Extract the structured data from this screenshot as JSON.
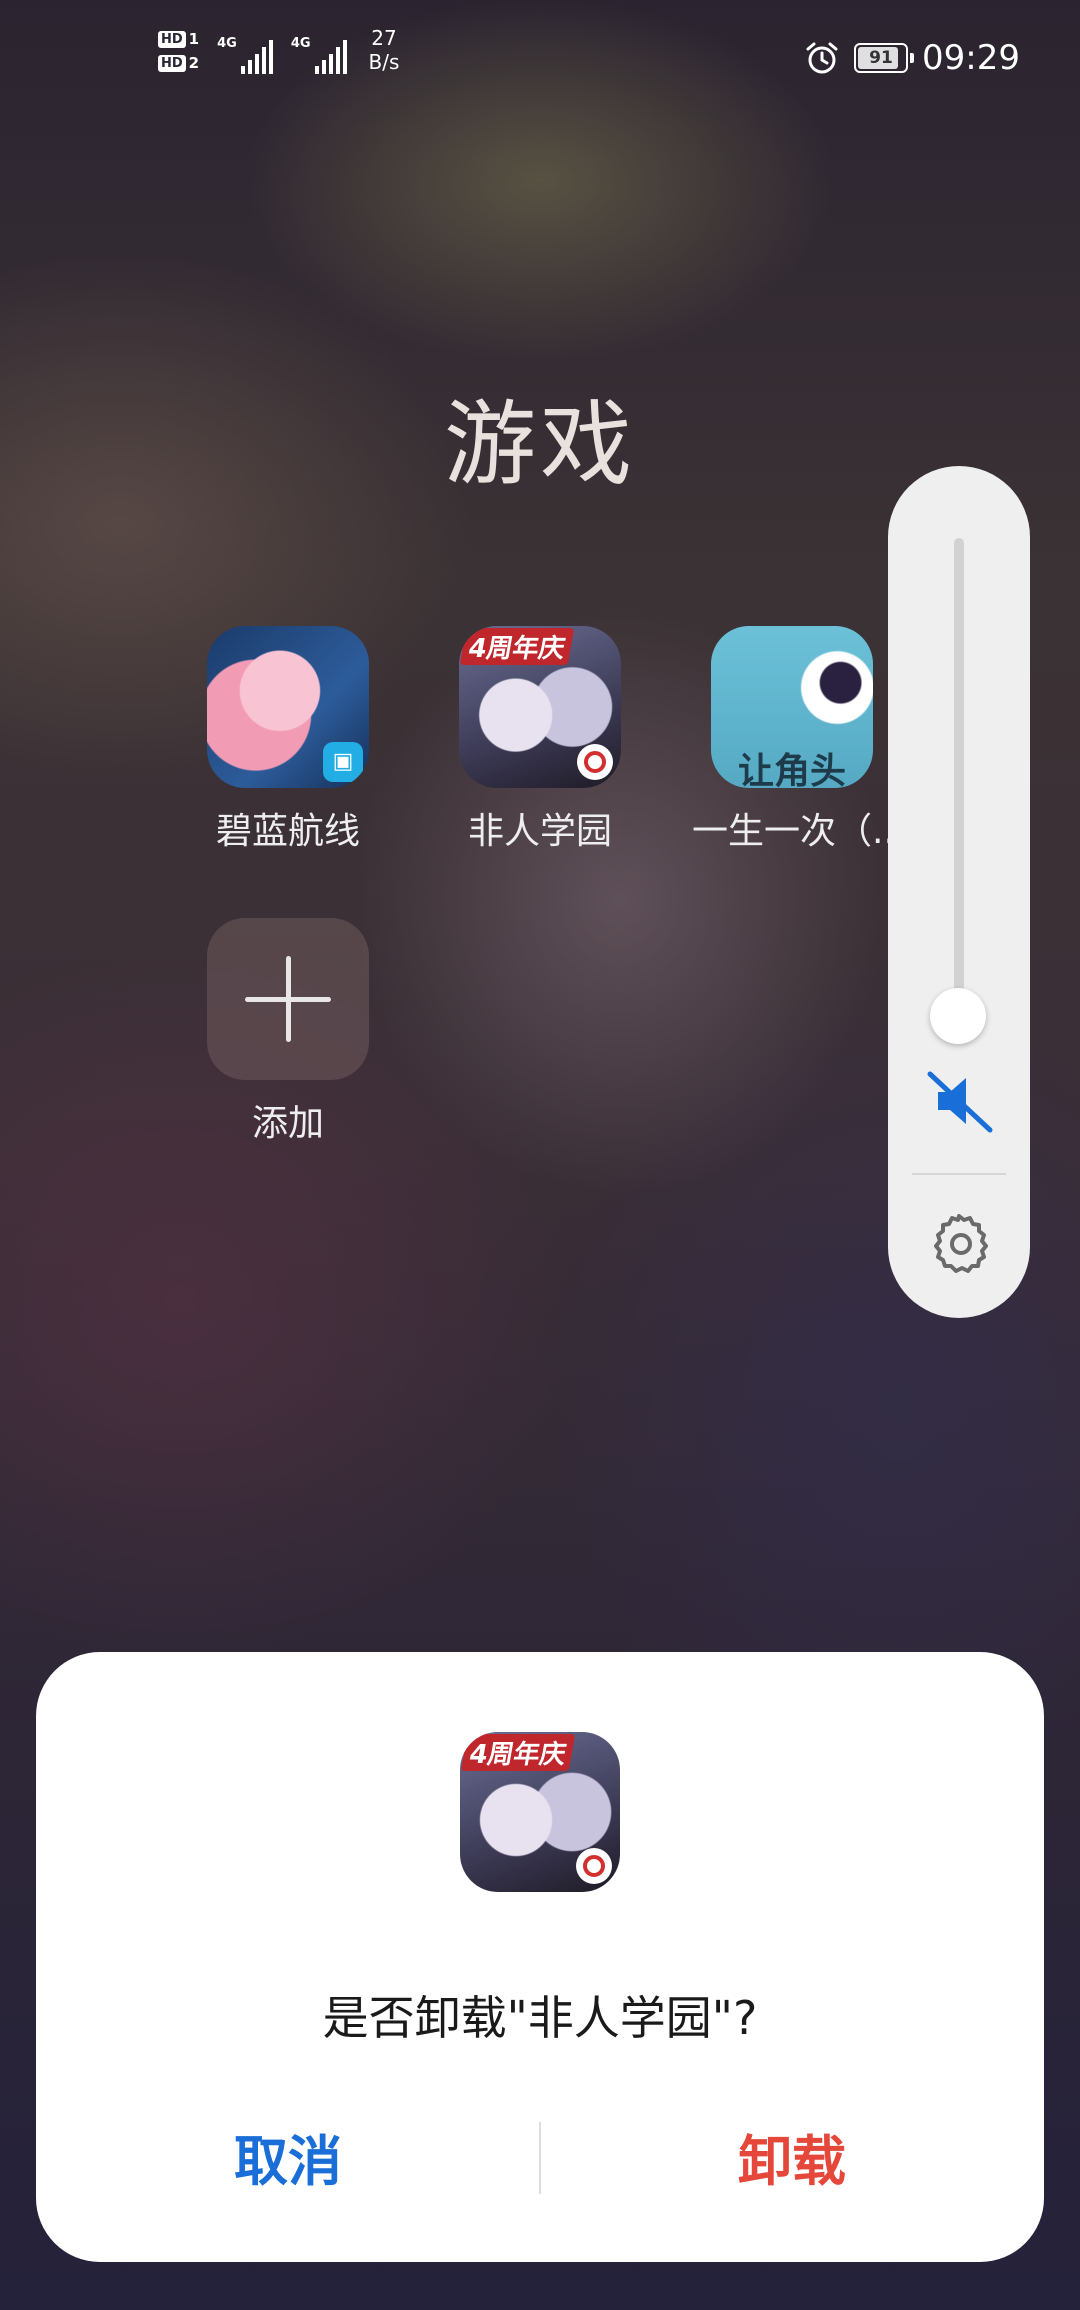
{
  "status_bar": {
    "hd1": "HD",
    "sim1": "1",
    "hd2": "HD",
    "sim2": "2",
    "net1": "4G",
    "net2": "4G",
    "speed_value": "27",
    "speed_unit": "B/s",
    "battery": "91",
    "time": "09:29"
  },
  "folder": {
    "title": "游戏",
    "apps": [
      {
        "label": "碧蓝航线",
        "icon": "azur-lane-icon"
      },
      {
        "label": "非人学园",
        "icon": "feiren-xueyuan-icon",
        "badge": "4周年庆"
      },
      {
        "label": "一生一次（...",
        "icon": "yisheng-yici-icon",
        "icon_text": "让角头"
      },
      {
        "label": "添加",
        "icon": "plus-icon"
      }
    ]
  },
  "volume": {
    "level": 0.0,
    "muted": true
  },
  "dialog": {
    "question": "是否卸载\"非人学园\"?",
    "cancel": "取消",
    "confirm": "卸载",
    "badge": "4周年庆"
  },
  "colors": {
    "cancel": "#1a6ed8",
    "confirm": "#e5473a",
    "mute_accent": "#1a6ed8"
  }
}
